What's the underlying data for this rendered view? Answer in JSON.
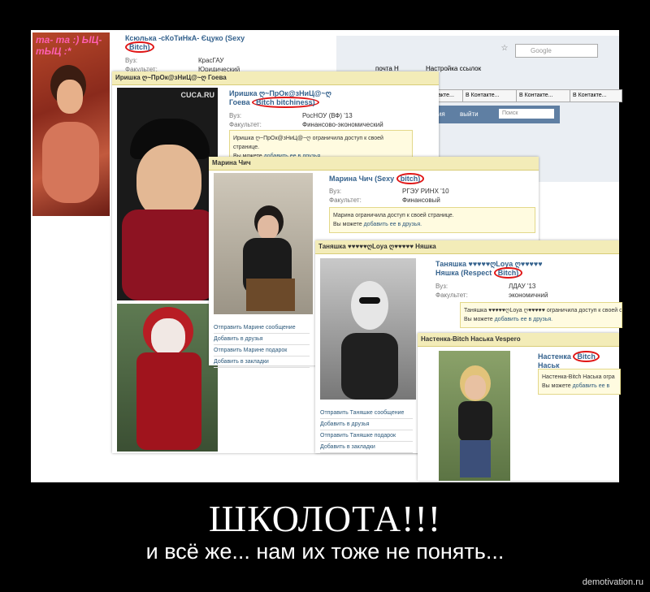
{
  "caption": {
    "title": "ШКОЛОТА!!!",
    "subtitle": "и всё же... нам их тоже не понять...",
    "watermark": "demotivation.ru"
  },
  "browser": {
    "search_placeholder": "Google",
    "bookmark1": "почта Н",
    "bookmark2": "Настройка ссылок",
    "tab_label": "В Контакте...",
    "tab_fragment": "акте...",
    "nav_fragment": "ения",
    "logout": "выйти",
    "search_box": "Поиск"
  },
  "p1": {
    "overlay": "ma- ma :) ЫЦ-тЫЦ :*",
    "name1": "Ксюлька -сКоТиНкА- Єцуко (Sexy",
    "name2": "Bitch)",
    "uni_label": "Вуз:",
    "uni": "КрасГАУ",
    "fac_label": "Факультет:",
    "fac": "Юридический"
  },
  "p2": {
    "header": "Иришка ღ~ПрОк@зНиЦ@~ღ Гоева",
    "name1": "Иришка ღ~ПрОк@зНиЦ@~ღ",
    "name2a": "Гоева",
    "name2b": "Bitch bitchiness)",
    "uni_label": "Вуз:",
    "uni": "РосНОУ (ВФ) '13",
    "fac_label": "Факультет:",
    "fac": "Финансово-экономический",
    "notice": "Иришка ღ~ПрОк@зНиЦ@~ღ ограничила доступ к своей странице.",
    "notice2a": "Вы можете ",
    "notice2b": "добавить ее в друзья.",
    "logo": "CUCA.RU"
  },
  "p3": {
    "header": "Марина Чич",
    "name1": "Марина Чич (Sexy",
    "name2": "bitch)",
    "uni_label": "Вуз:",
    "uni": "РГЭУ РИНХ '10",
    "fac_label": "Факультет:",
    "fac": "Финансовый",
    "notice": "Марина ограничила доступ к своей странице.",
    "notice2a": "Вы можете ",
    "notice2b": "добавить ее в друзья.",
    "menu": [
      "Отправить Марине сообщение",
      "Добавить в друзья",
      "Отправить Марине подарок",
      "Добавить в закладки"
    ]
  },
  "p4": {
    "header": "Таняшка ♥♥♥♥♥ღLoya ღ♥♥♥♥♥ Няшка",
    "name1": "Таняшка ♥♥♥♥♥ღLoya ღ♥♥♥♥♥",
    "name2a": "Няшка (Respect",
    "name2b": "Bitch)",
    "uni_label": "Вуз:",
    "uni": "ЛДАУ '13",
    "fac_label": "Факультет:",
    "fac": "экономичний",
    "notice": "Таняшка ♥♥♥♥♥ღLoya ღ♥♥♥♥♥ ограничила доступ к своей стра",
    "notice2a": "Вы можете ",
    "notice2b": "добавить ее в друзья.",
    "menu": [
      "Отправить Таняшке сообщение",
      "Добавить в друзья",
      "Отправить Таняшке подарок",
      "Добавить в закладки"
    ]
  },
  "p5": {
    "header": "Настенка-Bitch Наська Vespero",
    "name1": "Настенка",
    "name2": "Bitch",
    "name3": "Наськ",
    "notice": "Настенка-Bitch Наська огра",
    "notice2a": "Вы можете ",
    "notice2b": "добавить ее в"
  }
}
